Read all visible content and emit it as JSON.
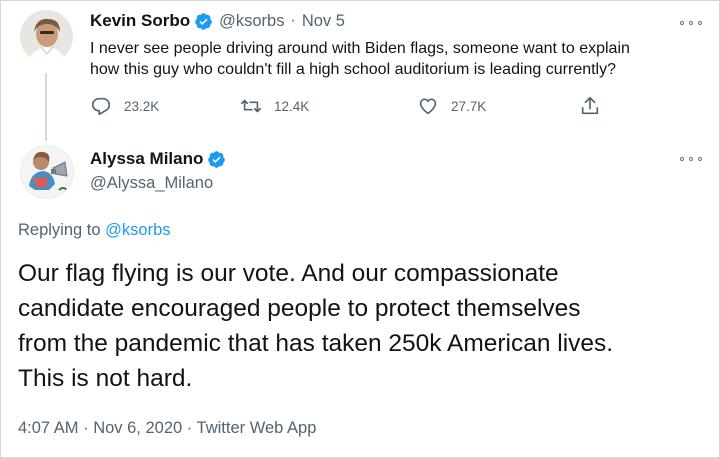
{
  "original_tweet": {
    "display_name": "Kevin Sorbo",
    "handle": "@ksorbs",
    "separator": "·",
    "date": "Nov 5",
    "text_line1": "I never see people driving around with Biden flags, someone want to explain",
    "text_line2": "how this guy who couldn't fill a high school auditorium is leading currently?",
    "replies": "23.2K",
    "retweets": "12.4K",
    "likes": "27.7K"
  },
  "reply_tweet": {
    "display_name": "Alyssa Milano",
    "handle": "@Alyssa_Milano",
    "replying_prefix": "Replying to",
    "replying_to": "@ksorbs",
    "text_line1": "Our flag flying is our vote. And our compassionate",
    "text_line2": "candidate encouraged people to protect themselves",
    "text_line3": "from the pandemic that has taken 250k American lives.",
    "text_line4": "This is not hard.",
    "timestamp": "4:07 AM · Nov 6, 2020 · Twitter Web App"
  },
  "colors": {
    "verified": "#1d9bf0",
    "secondary_text": "#536471",
    "link": "#1d9bf0",
    "border": "#cfd9de"
  },
  "icons": [
    "verified-badge-icon",
    "more-options-icon",
    "reply-icon",
    "retweet-icon",
    "like-icon",
    "share-icon"
  ]
}
